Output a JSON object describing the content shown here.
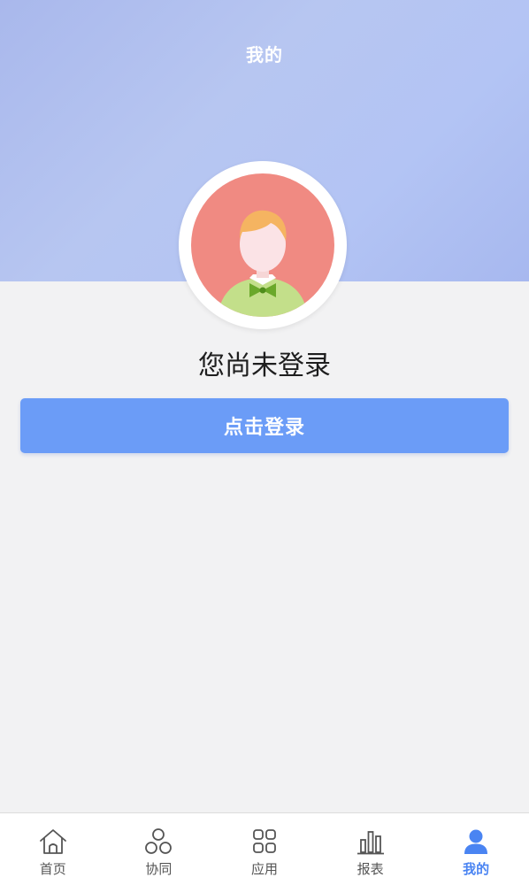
{
  "header": {
    "title": "我的"
  },
  "profile": {
    "status_text": "您尚未登录",
    "login_button_label": "点击登录"
  },
  "tabbar": {
    "active_color": "#4a84f2",
    "items": [
      {
        "label": "首页",
        "icon": "home-icon",
        "active": false
      },
      {
        "label": "协同",
        "icon": "collaboration-icon",
        "active": false
      },
      {
        "label": "应用",
        "icon": "apps-grid-icon",
        "active": false
      },
      {
        "label": "报表",
        "icon": "bar-chart-icon",
        "active": false
      },
      {
        "label": "我的",
        "icon": "user-icon",
        "active": true
      }
    ]
  }
}
